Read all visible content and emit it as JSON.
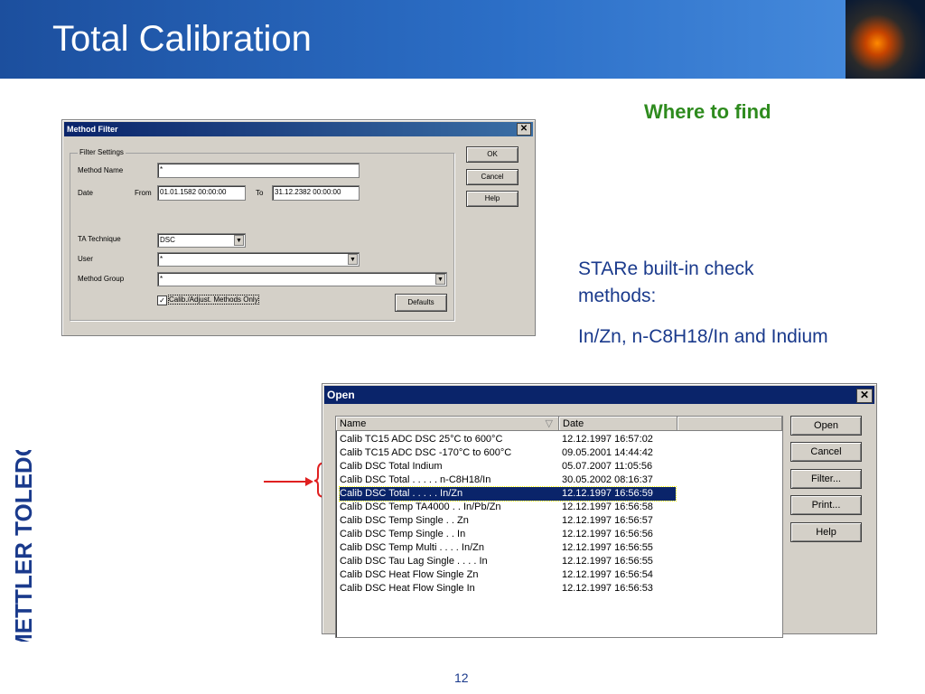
{
  "slide": {
    "title": "Total Calibration",
    "heading": "Where to find",
    "desc_line1": "STARe built-in check",
    "desc_line2": "methods:",
    "desc_line3": "In/Zn, n-C8H18/In and Indium",
    "page_number": "12",
    "logo_text": "METTLER TOLEDO"
  },
  "method_filter": {
    "title": "Method Filter",
    "close_glyph": "✕",
    "group_label": "Filter Settings",
    "method_name_label": "Method Name",
    "method_name_value": "*",
    "date_label": "Date",
    "from_label": "From",
    "from_value": "01.01.1582 00:00:00",
    "to_label": "To",
    "to_value": "31.12.2382 00:00:00",
    "ta_label": "TA Technique",
    "ta_value": "DSC",
    "user_label": "User",
    "user_value": "*",
    "group_method_label": "Method Group",
    "group_method_value": "*",
    "checkbox_label": "Calib./Adjust. Methods Only",
    "checkbox_checked": "✓",
    "ok": "OK",
    "cancel": "Cancel",
    "help": "Help",
    "defaults": "Defaults"
  },
  "open_dialog": {
    "title": "Open",
    "close_glyph": "✕",
    "col_name": "Name",
    "sort_glyph": "▽",
    "col_date": "Date",
    "rows": [
      {
        "name": "Calib TC15 ADC DSC 25°C to  600°C",
        "date": "12.12.1997 16:57:02"
      },
      {
        "name": "Calib TC15 ADC DSC -170°C to  600°C",
        "date": "09.05.2001 14:44:42"
      },
      {
        "name": "Calib DSC Total Indium",
        "date": "05.07.2007 11:05:56"
      },
      {
        "name": "Calib DSC Total  . . . . . n-C8H18/In",
        "date": "30.05.2002 08:16:37"
      },
      {
        "name": "Calib DSC Total  . . . . . In/Zn",
        "date": "12.12.1997 16:56:59"
      },
      {
        "name": "Calib DSC Temp TA4000 . .  In/Pb/Zn",
        "date": "12.12.1997 16:56:58"
      },
      {
        "name": "Calib DSC Temp Single . .  Zn",
        "date": "12.12.1997 16:56:57"
      },
      {
        "name": "Calib DSC Temp Single . .  In",
        "date": "12.12.1997 16:56:56"
      },
      {
        "name": "Calib DSC Temp Multi . . . . In/Zn",
        "date": "12.12.1997 16:56:55"
      },
      {
        "name": "Calib DSC Tau Lag Single . . . . In",
        "date": "12.12.1997 16:56:55"
      },
      {
        "name": "Calib DSC Heat Flow Single Zn",
        "date": "12.12.1997 16:56:54"
      },
      {
        "name": "Calib DSC Heat Flow Single In",
        "date": "12.12.1997 16:56:53"
      }
    ],
    "btn_open": "Open",
    "btn_cancel": "Cancel",
    "btn_filter": "Filter...",
    "btn_print": "Print...",
    "btn_help": "Help"
  }
}
